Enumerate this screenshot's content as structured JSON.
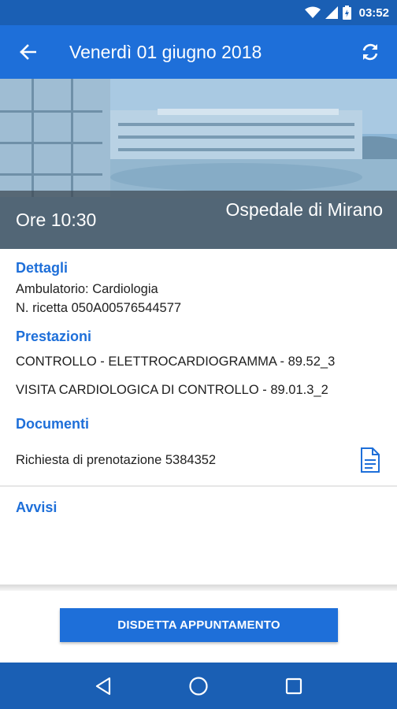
{
  "status_bar": {
    "time": "03:52",
    "icons": [
      "wifi-icon",
      "signal-icon",
      "battery-icon"
    ]
  },
  "toolbar": {
    "back_icon": "arrow-back-icon",
    "title": "Venerdì 01 giugno 2018",
    "refresh_icon": "refresh-icon"
  },
  "hero": {
    "time_label": "Ore 10:30",
    "hospital": "Ospedale di Mirano"
  },
  "details": {
    "title": "Dettagli",
    "ambulatorio": "Ambulatorio: Cardiologia",
    "ricetta": "N. ricetta 050A00576544577"
  },
  "prestazioni": {
    "title": "Prestazioni",
    "items": [
      "CONTROLLO - ELETTROCARDIOGRAMMA - 89.52_3",
      "VISITA CARDIOLOGICA DI CONTROLLO - 89.01.3_2"
    ]
  },
  "documenti": {
    "title": "Documenti",
    "items": [
      {
        "label": "Richiesta di prenotazione 5384352",
        "icon": "document-icon"
      }
    ]
  },
  "avvisi": {
    "title": "Avvisi"
  },
  "actions": {
    "cancel_label": "DISDETTA APPUNTAMENTO"
  },
  "nav_bar": {
    "icons": [
      "back-triangle-icon",
      "home-circle-icon",
      "recents-square-icon"
    ]
  },
  "colors": {
    "primary": "#1e6fd9",
    "primary_dark": "#1a5fb4",
    "section_title": "#1e6fd9",
    "text": "#212121"
  }
}
